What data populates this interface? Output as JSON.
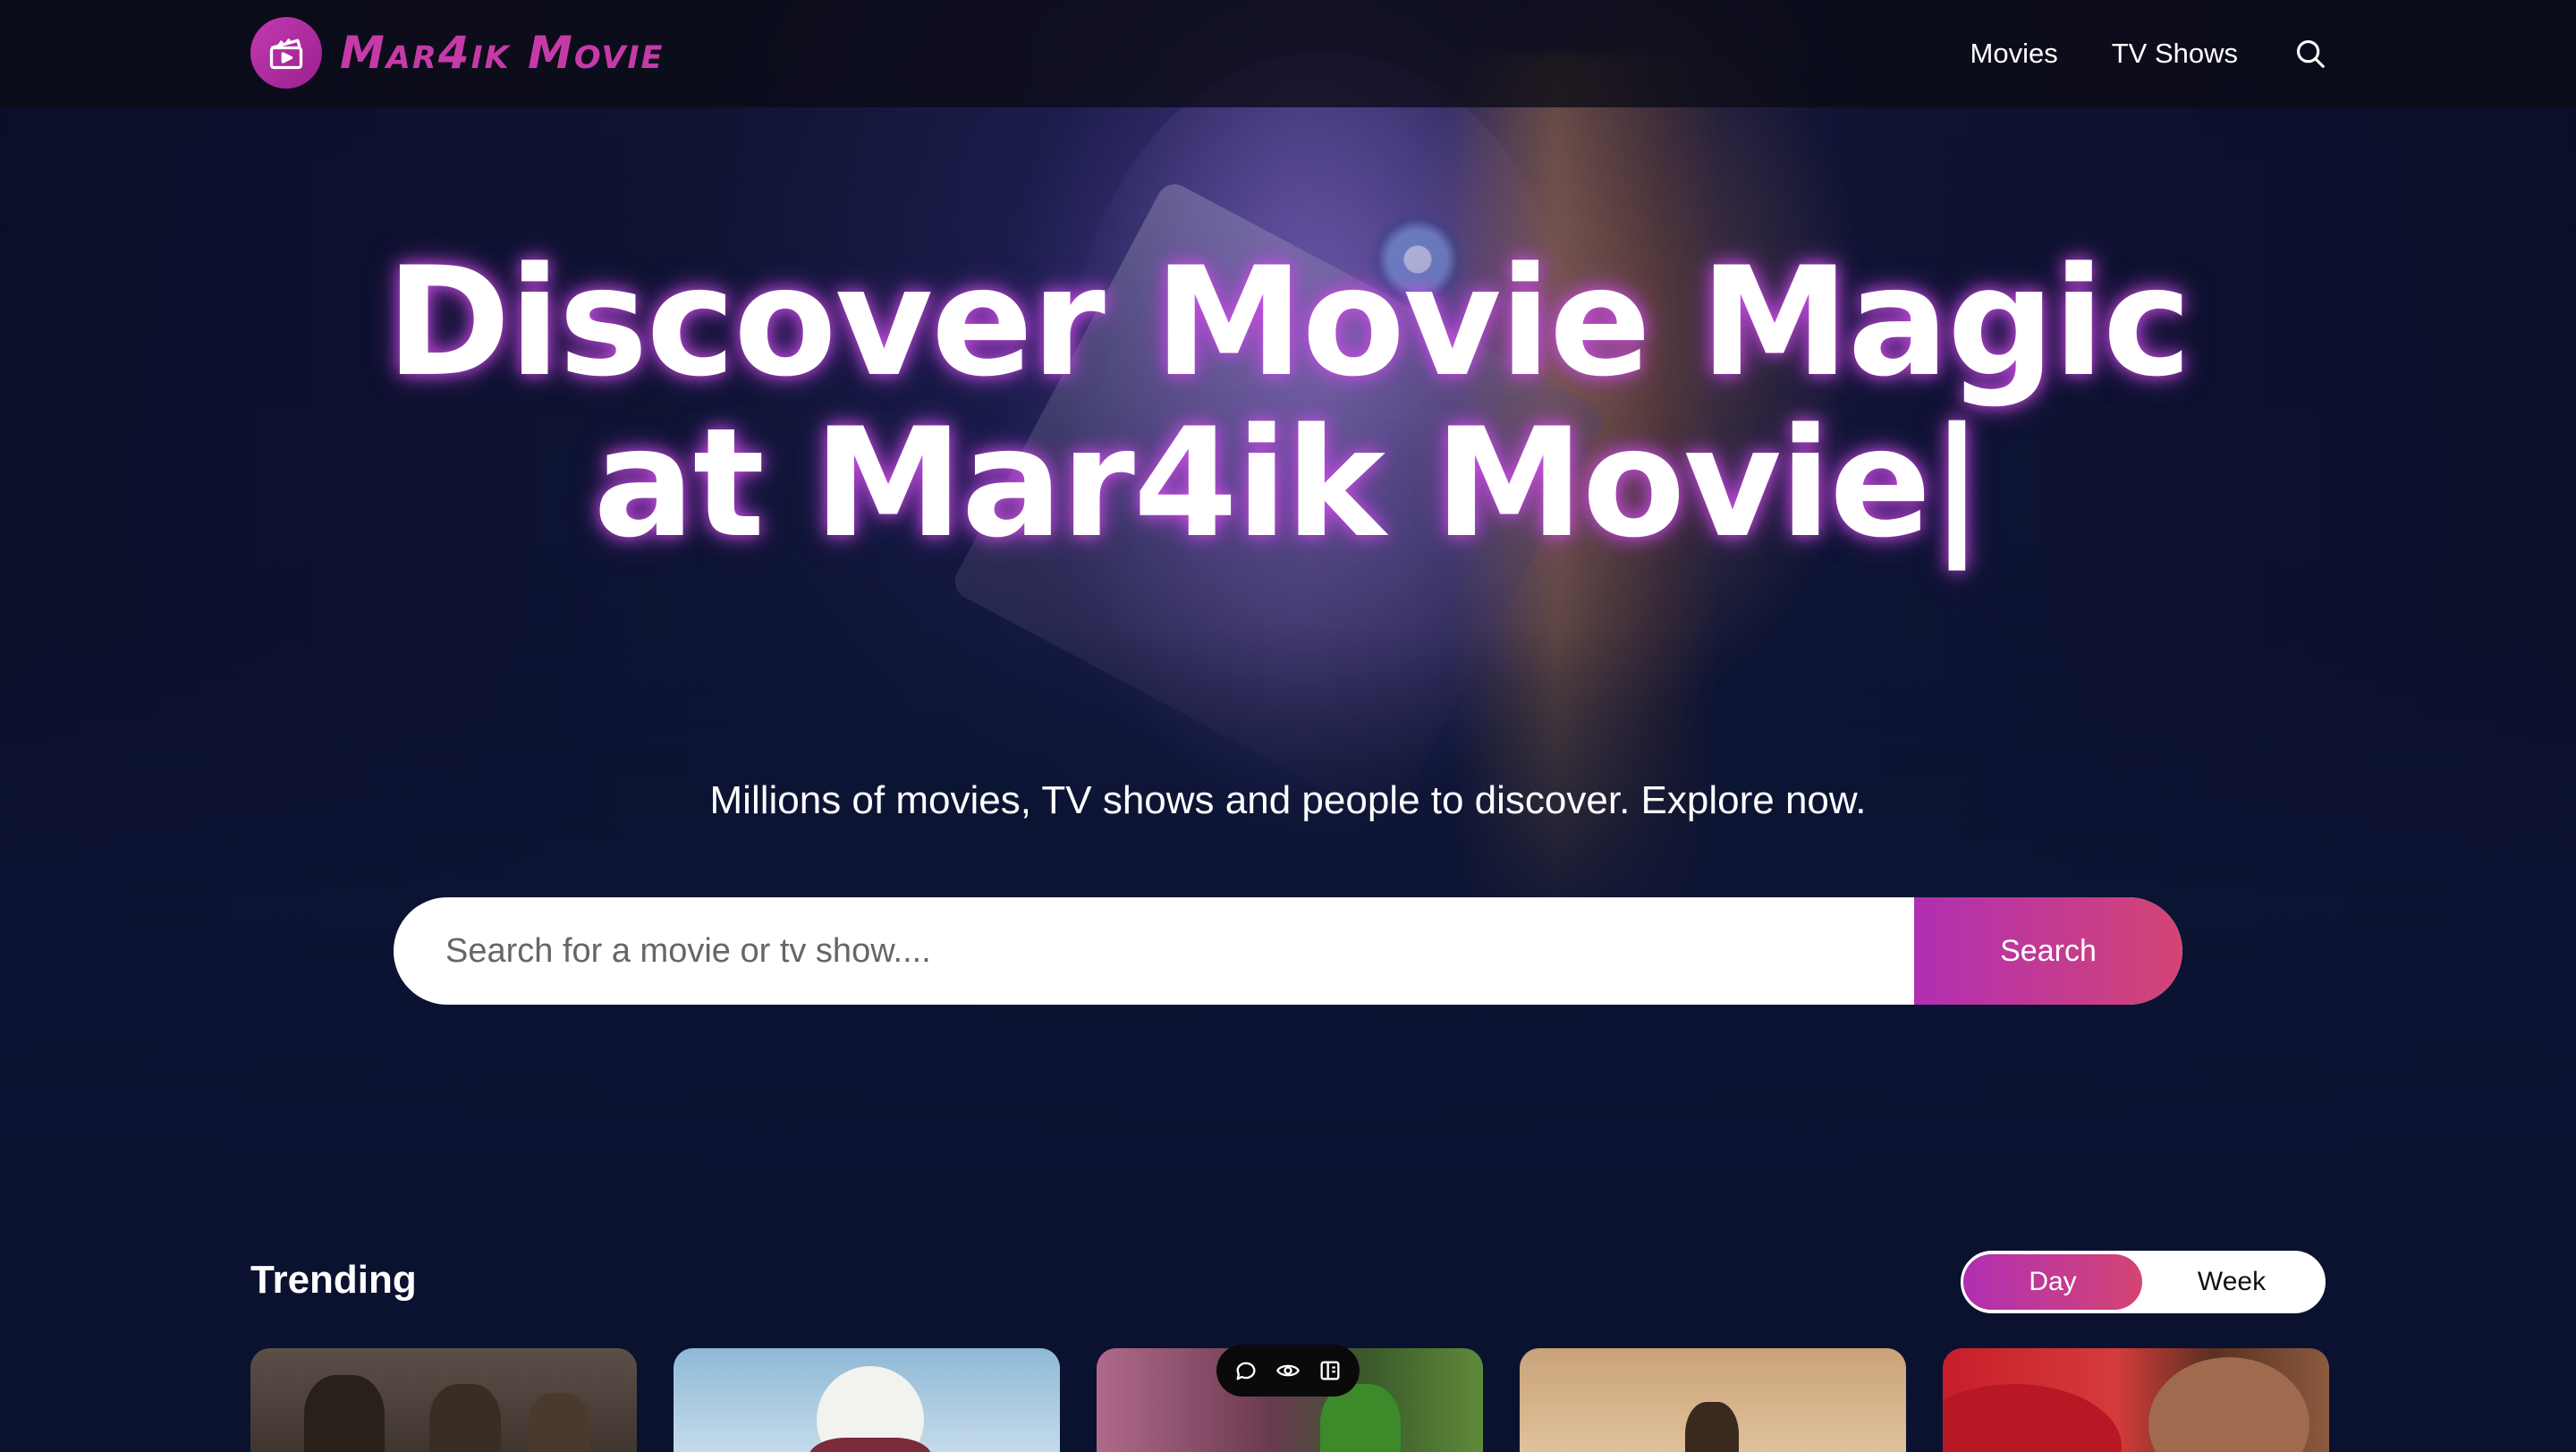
{
  "header": {
    "logo_text": "Mar4ik Movie",
    "nav": {
      "movies": "Movies",
      "tv_shows": "TV Shows"
    }
  },
  "hero": {
    "title_line1": "Discover Movie Magic",
    "title_line2": "at Mar4ik Movie|",
    "subtitle": "Millions of movies, TV shows and people to discover. Explore now.",
    "search": {
      "placeholder": "Search for a movie or tv show....",
      "value": "",
      "button_label": "Search"
    }
  },
  "trending": {
    "title": "Trending",
    "tabs": [
      {
        "label": "Day",
        "active": true
      },
      {
        "label": "Week",
        "active": false
      }
    ],
    "cards": [
      {
        "icon": "poster-image"
      },
      {
        "icon": "poster-image"
      },
      {
        "icon": "poster-image"
      },
      {
        "icon": "poster-image"
      },
      {
        "icon": "poster-image"
      }
    ]
  },
  "floating_toolbar": {
    "icons": [
      "comment-icon",
      "eye-icon",
      "panel-icon"
    ]
  },
  "colors": {
    "accent_start": "#b02fb3",
    "accent_end": "#d44573",
    "logo": "#c63aa8",
    "background": "#0b1230"
  }
}
